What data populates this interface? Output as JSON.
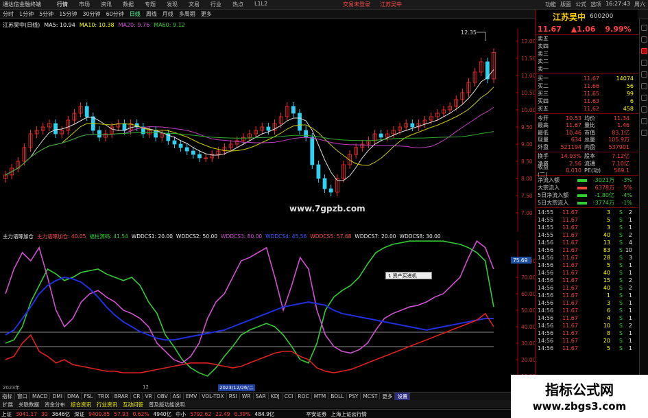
{
  "titlebar": {
    "app": "通达信金融终端",
    "menu": [
      "行情",
      "市场",
      "资讯",
      "数据",
      "专题",
      "发现",
      "文易",
      "行业",
      "热点",
      "L1L2"
    ],
    "notice1": "交易未登录",
    "notice2": "江苏吴中",
    "right": [
      "功能",
      "版面",
      "公式",
      "选项"
    ],
    "clock": "16:27:43",
    "weekday": "周六"
  },
  "toolbar": {
    "items": [
      "分时",
      "1分钟",
      "5分钟",
      "15分钟",
      "30分钟",
      "60分钟",
      "日线",
      "周线",
      "月线",
      "多周期",
      "更多"
    ],
    "active": "日线"
  },
  "chartinfo": {
    "stock": "江苏吴中(日线)",
    "ma5": "MA5: 10.94",
    "ma10": "MA10: 10.38",
    "ma20": "MA20: 9.76",
    "ma60": "MA60: 9.12"
  },
  "main_axis": {
    "ticks": [
      "12.00",
      "11.50",
      "11.00",
      "10.50",
      "10.00",
      "9.50",
      "9.00",
      "8.50",
      "8.00",
      "7.50",
      "7.00"
    ],
    "marker_top": "12.35"
  },
  "watermark": "www.7gpzb.com",
  "indinfo": {
    "name": "主力语琢加仓",
    "items": [
      "主力语琢加仓: 40.05",
      "福柱源码: 41.54",
      "WDDCS1: 20.00",
      "WDDCS2: 50.00",
      "WDDCS3: 80.00",
      "WDDCS4: 45.56",
      "WDDCS5: 57.68",
      "WDDCS7: 20.00",
      "WDDCS8: 30.00"
    ]
  },
  "ind_axis": {
    "ticks": [
      "80.00",
      "70.00",
      "60.00",
      "50.00",
      "40.00",
      "30.00",
      "20.00",
      "10.00"
    ],
    "current": "75.69"
  },
  "tooltip": "1 资产买进机",
  "datebar": {
    "left": "2023年",
    "mid": "12",
    "selected": "2023/12/26/二"
  },
  "tabbar": {
    "items": [
      "指标",
      "窗口",
      "MACD",
      "DMI",
      "DMA",
      "FSL",
      "TRIX",
      "BRAR",
      "CR",
      "VR",
      "OBV",
      "ASI",
      "EMV",
      "VOL-TDX",
      "RSI",
      "WR",
      "SAR",
      "KDJ",
      "CCI",
      "ROC",
      "MTM",
      "BOLL",
      "PSY",
      "MCST",
      "更多",
      "设置"
    ],
    "active": "设置",
    "right": "模板"
  },
  "tabbar2": {
    "items": [
      "扩展",
      "关联数据",
      "资金分布",
      "综合资讯",
      "行业资讯",
      "互动问答",
      "普及版功能说明"
    ],
    "highlight": [
      "综合资讯",
      "行业资讯",
      "互动问答"
    ]
  },
  "statusbar": {
    "sh_label": "上证",
    "sh_val": "3041.17",
    "sh_chg": "30",
    "sh_amt": "3646亿",
    "sz_label": "深证",
    "sz_val": "9400.85",
    "sz_chg": "57.93",
    "sz_pct": "0.62%",
    "sz_amt": "4940亿",
    "zx_label": "中小",
    "zx_val": "5792.62",
    "zx_chg": "22.49",
    "zx_pct": "0.39%",
    "zx_amt": "484.9亿",
    "broker": "平安证券",
    "market": "上海上证云行情"
  },
  "right_panel": {
    "name": "江苏吴中",
    "code": "600200",
    "price": "11.67",
    "change": "▲1.06",
    "pct": "9.99%",
    "asks": [
      {
        "label": "卖五",
        "price": "",
        "vol": ""
      },
      {
        "label": "卖四",
        "price": "",
        "vol": ""
      },
      {
        "label": "卖三",
        "price": "",
        "vol": ""
      },
      {
        "label": "卖二",
        "price": "",
        "vol": ""
      },
      {
        "label": "卖一",
        "price": "",
        "vol": ""
      }
    ],
    "bids": [
      {
        "label": "买一",
        "price": "11.67",
        "vol": "14074"
      },
      {
        "label": "买二",
        "price": "11.66",
        "vol": "56"
      },
      {
        "label": "买三",
        "price": "11.65",
        "vol": "99"
      },
      {
        "label": "买四",
        "price": "11.63",
        "vol": "6"
      },
      {
        "label": "买五",
        "price": "11.62",
        "vol": "458"
      }
    ],
    "stats": [
      {
        "a": "今开",
        "b": "10.53",
        "c": "均价",
        "d": "11.34"
      },
      {
        "a": "最高",
        "b": "11.67",
        "c": "量比",
        "d": "1.46"
      },
      {
        "a": "最低",
        "b": "10.46",
        "c": "市值",
        "d": "83.1亿"
      },
      {
        "a": "现量",
        "b": "634",
        "c": "总量",
        "d": "105.9万"
      },
      {
        "a": "外盘",
        "b": "521194",
        "c": "内盘",
        "d": "537901"
      }
    ],
    "stats2": [
      {
        "a": "换手",
        "b": "14.93%",
        "c": "股本",
        "d": "7.12亿"
      },
      {
        "a": "净资",
        "b": "2.56",
        "c": "流通",
        "d": "7.10亿"
      },
      {
        "a": "收益(二)",
        "b": "0.010",
        "c": "PE(动)",
        "d": "569.1"
      }
    ],
    "flows": [
      {
        "label": "净流入额",
        "val": "-3021万",
        "pct": "-3%",
        "color": "#3c3"
      },
      {
        "label": "大宗流入",
        "val": "6378万",
        "pct": "5%",
        "color": "#f44"
      },
      {
        "label": "5日净流入额",
        "val": "-1.80亿",
        "pct": "-4%",
        "color": "#3c3"
      },
      {
        "label": "5日大宗流入",
        "val": "-3774万",
        "pct": "-1%",
        "color": "#3c3"
      }
    ],
    "ticks": [
      {
        "t": "14:55",
        "p": "11.67",
        "v": "3",
        "s": "S",
        "n": "2"
      },
      {
        "t": "14:55",
        "p": "11.67",
        "v": "5",
        "s": "S",
        "n": "1"
      },
      {
        "t": "14:55",
        "p": "11.67",
        "v": "3",
        "s": "S",
        "n": "1"
      },
      {
        "t": "14:55",
        "p": "11.67",
        "v": "40",
        "s": "S",
        "n": "2"
      },
      {
        "t": "14:56",
        "p": "11.67",
        "v": "13",
        "s": "S",
        "n": "4"
      },
      {
        "t": "14:56",
        "p": "11.67",
        "v": "83",
        "s": "S",
        "n": "10"
      },
      {
        "t": "14:56",
        "p": "11.67",
        "v": "28",
        "s": "S",
        "n": "3"
      },
      {
        "t": "14:56",
        "p": "11.67",
        "v": "5",
        "s": "S",
        "n": "1"
      },
      {
        "t": "14:56",
        "p": "11.67",
        "v": "40",
        "s": "S",
        "n": "1"
      },
      {
        "t": "14:56",
        "p": "11.67",
        "v": "15",
        "s": "S",
        "n": "2"
      },
      {
        "t": "14:56",
        "p": "11.67",
        "v": "40",
        "s": "S",
        "n": "2"
      },
      {
        "t": "14:56",
        "p": "11.67",
        "v": "1",
        "s": "S",
        "n": "1"
      },
      {
        "t": "14:56",
        "p": "11.67",
        "v": "3",
        "s": "S",
        "n": "1"
      },
      {
        "t": "14:56",
        "p": "11.67",
        "v": "6",
        "s": "S",
        "n": "1"
      },
      {
        "t": "14:56",
        "p": "11.67",
        "v": "4",
        "s": "S",
        "n": "1"
      },
      {
        "t": "14:56",
        "p": "11.67",
        "v": "10",
        "s": "S",
        "n": "2"
      },
      {
        "t": "14:56",
        "p": "11.67",
        "v": "8",
        "s": "S",
        "n": "1"
      },
      {
        "t": "14:56",
        "p": "11.67",
        "v": "20",
        "s": "S",
        "n": "1"
      },
      {
        "t": "14:56",
        "p": "11.67",
        "v": "5",
        "s": "S",
        "n": "1"
      }
    ]
  },
  "logo": {
    "line1": "指标公式网",
    "line2": "www.zbgs3.com"
  }
}
